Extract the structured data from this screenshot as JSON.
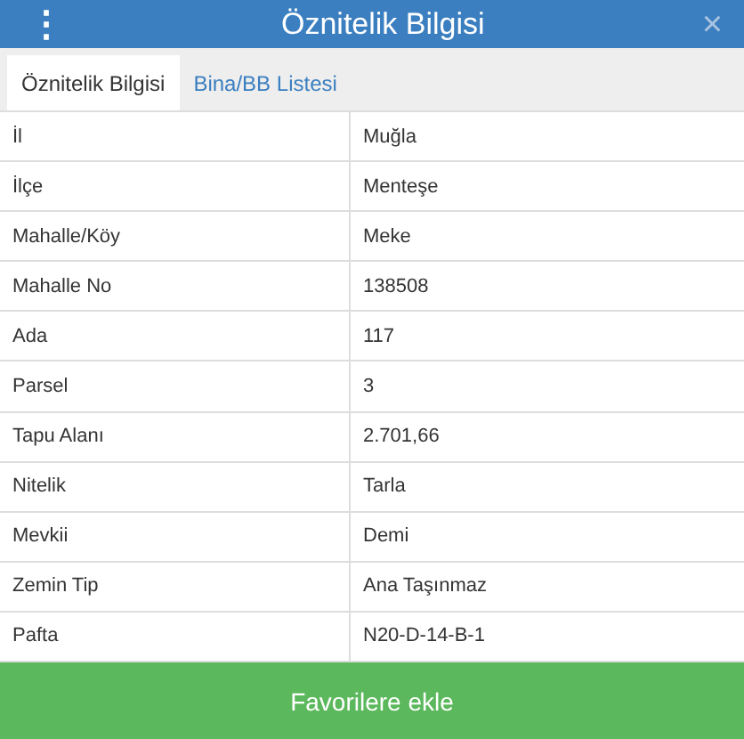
{
  "header": {
    "menu_icon": "⋮",
    "title": "Öznitelik Bilgisi",
    "close_icon": "×"
  },
  "tabs": [
    {
      "label": "Öznitelik Bilgisi",
      "selected": true
    },
    {
      "label": "Bina/BB Listesi",
      "selected": false
    }
  ],
  "rows": [
    {
      "label": "İl",
      "value": "Muğla"
    },
    {
      "label": "İlçe",
      "value": "Menteşe"
    },
    {
      "label": "Mahalle/Köy",
      "value": "Meke"
    },
    {
      "label": "Mahalle No",
      "value": "138508"
    },
    {
      "label": "Ada",
      "value": "117"
    },
    {
      "label": "Parsel",
      "value": "3"
    },
    {
      "label": "Tapu Alanı",
      "value": "2.701,66"
    },
    {
      "label": "Nitelik",
      "value": "Tarla"
    },
    {
      "label": "Mevkii",
      "value": "Demi"
    },
    {
      "label": "Zemin Tip",
      "value": "Ana Taşınmaz"
    },
    {
      "label": "Pafta",
      "value": "N20-D-14-B-1"
    }
  ],
  "footer_button": "Favorilere ekle"
}
